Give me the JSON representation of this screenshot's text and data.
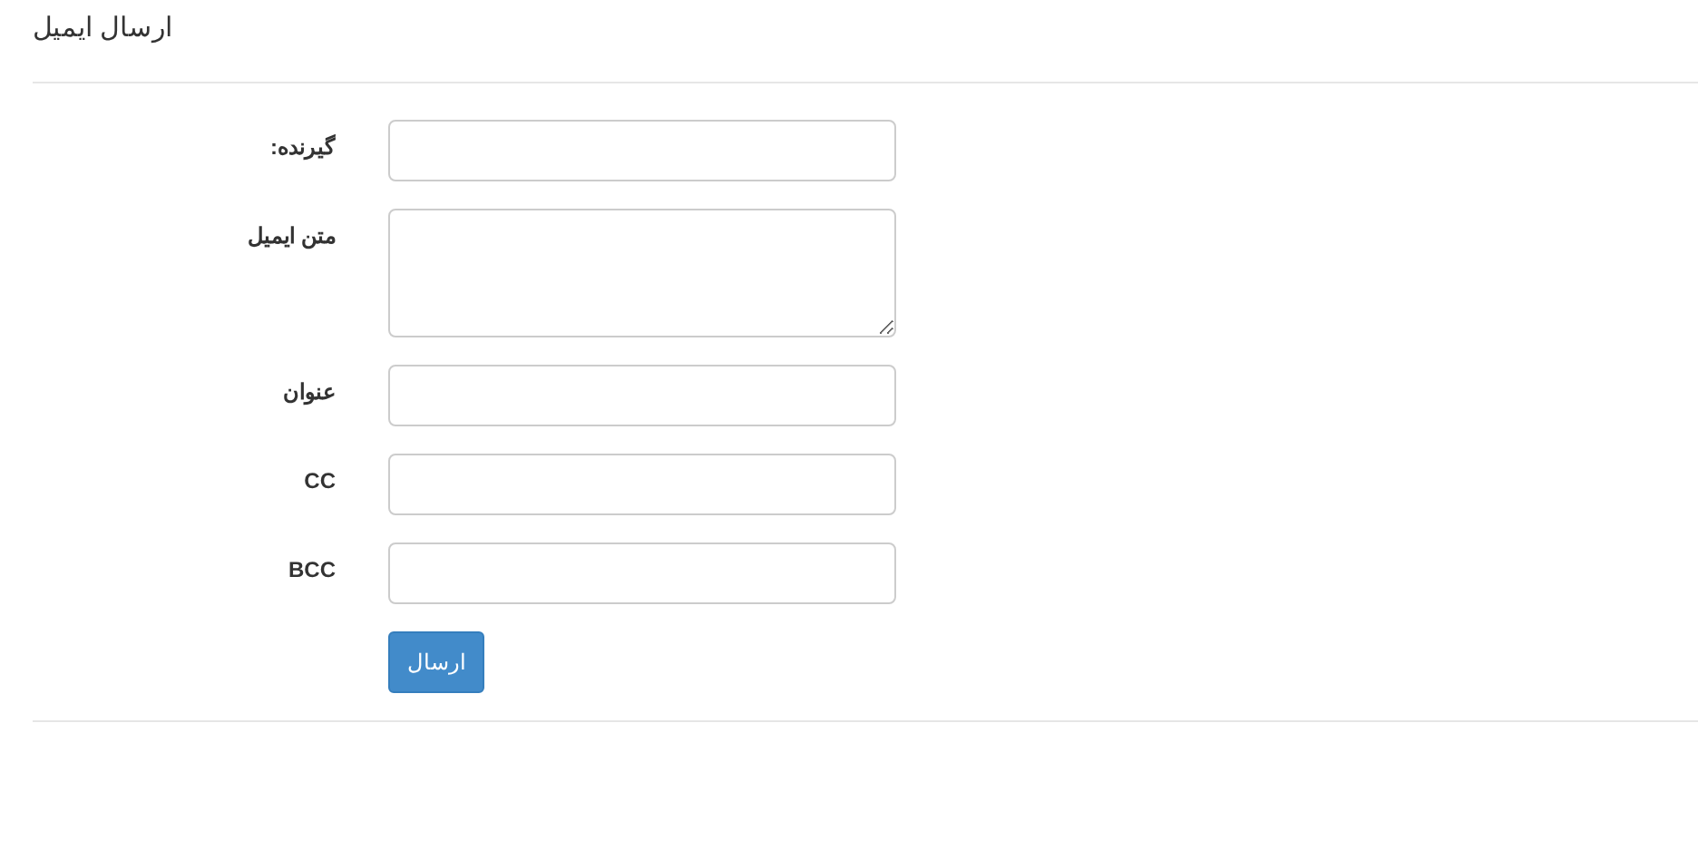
{
  "page_title": "ارسال ایمیل",
  "fields": [
    {
      "label": "گیرنده:",
      "kind": "input"
    },
    {
      "label": "متن ایمیل",
      "kind": "textarea"
    },
    {
      "label": "عنوان",
      "kind": "input"
    },
    {
      "label": "CC",
      "kind": "input"
    },
    {
      "label": "BCC",
      "kind": "input"
    }
  ],
  "submit_button": "ارسال"
}
